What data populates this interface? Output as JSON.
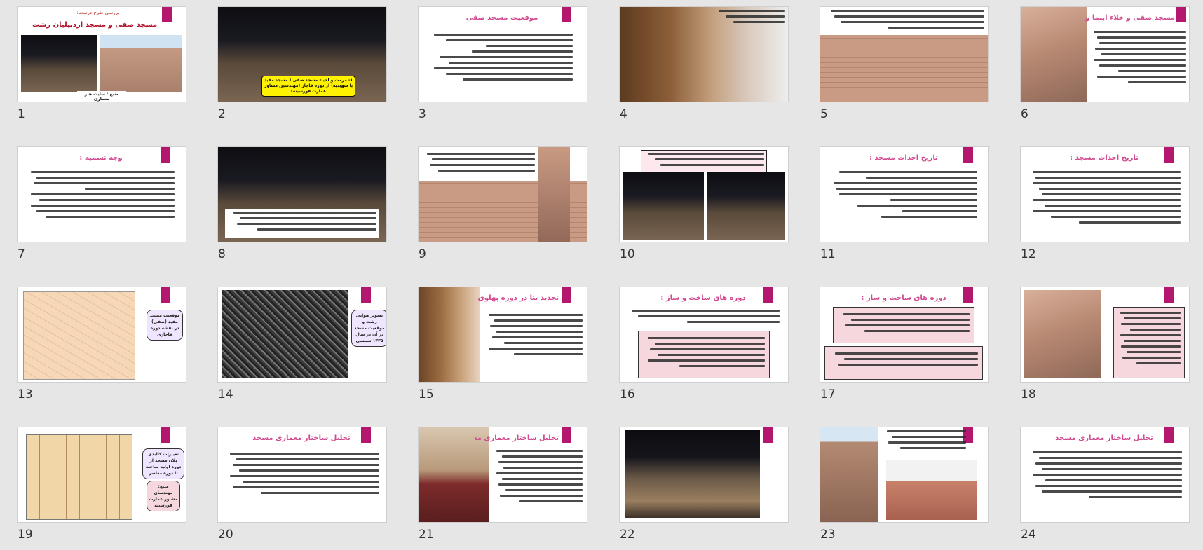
{
  "view": "slide-sorter",
  "slides": [
    {
      "n": "1",
      "title": "",
      "subtitle": "بررسی طرح درست:",
      "heading": "مسجد صفی و مسجد اردبیلیان رشت",
      "caption": "منبع : سایت هنر معماری"
    },
    {
      "n": "2",
      "title": "",
      "caption": "۱- مرمت و احیاء مسجد صفی ( مسجد مفید یا شهیدیه) از دوره قاجار (مهندسین مشاور عمارت فورسینه)"
    },
    {
      "n": "3",
      "title": "موقعیت مسجد صفی"
    },
    {
      "n": "4",
      "title": ""
    },
    {
      "n": "5",
      "title": ""
    },
    {
      "n": "6",
      "title": "مسجد صفی و خلاء آبنما و رودبار :"
    },
    {
      "n": "7",
      "title": "وجه تسمیه :"
    },
    {
      "n": "8",
      "title": ""
    },
    {
      "n": "9",
      "title": ""
    },
    {
      "n": "10",
      "title": ""
    },
    {
      "n": "11",
      "title": "تاریخ احداث مسجد :"
    },
    {
      "n": "12",
      "title": "تاریخ احداث مسجد :"
    },
    {
      "n": "13",
      "title": "",
      "badge": "موقعیت مسجد مفید (صفی) در نقشه دوره قاجاری"
    },
    {
      "n": "14",
      "title": "",
      "badge": "تصویر هوایی رشت و موقعیت مسجد در آن در سال ۱۳۳۵ شمسی"
    },
    {
      "n": "15",
      "title": "تجدید بنا در دوره پهلوی اول :"
    },
    {
      "n": "16",
      "title": "دوره های ساخت و ساز :"
    },
    {
      "n": "17",
      "title": "دوره های ساخت و ساز :"
    },
    {
      "n": "18",
      "title": ""
    },
    {
      "n": "19",
      "title": "",
      "badge": "تغییرات کالبدی پلان مسجد از دوره اولیه ساخت تا دوره معاصر",
      "badge2": "منبع: مهندسان مشاور عمارت فورسینه"
    },
    {
      "n": "20",
      "title": "تحلیل ساختار معماری مسجد"
    },
    {
      "n": "21",
      "title": "تحلیل ساختار معماری مسجد"
    },
    {
      "n": "22",
      "title": ""
    },
    {
      "n": "23",
      "title": ""
    },
    {
      "n": "24",
      "title": "تحلیل ساختار معماری مسجد"
    }
  ],
  "colors": {
    "accent": "#b3176e",
    "title": "#d14a8f",
    "background": "#e6e6e6"
  }
}
